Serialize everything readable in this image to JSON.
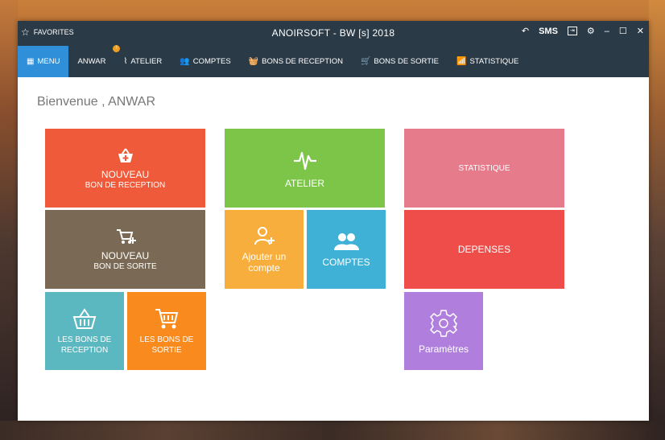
{
  "window": {
    "favorites_label": "FAVORITES",
    "title": "ANOIRSOFT - BW [s] 2018",
    "sms_label": "SMS"
  },
  "menu": {
    "items": [
      {
        "label": "MENU",
        "icon": "grid-icon"
      },
      {
        "label": "ANWAR",
        "icon": "user-icon",
        "badge": "!"
      },
      {
        "label": "ATELIER",
        "icon": "pulse-icon"
      },
      {
        "label": "COMPTES",
        "icon": "users-icon"
      },
      {
        "label": "BONS DE RECEPTION",
        "icon": "basket-icon"
      },
      {
        "label": "BONS DE SORTIE",
        "icon": "cart-icon"
      },
      {
        "label": "STATISTIQUE",
        "icon": "bar-chart-icon"
      }
    ]
  },
  "welcome": "Bienvenue , ANWAR",
  "tiles": {
    "nouveau_reception": {
      "line1": "NOUVEAU",
      "line2": "BON DE RECEPTION",
      "color": "#ef5a3a"
    },
    "nouveau_sortie": {
      "line1": "NOUVEAU",
      "line2": "BON DE SORITE",
      "color": "#7a6a55"
    },
    "les_bons_reception": {
      "line1": "LES BONS DE",
      "line2": "RECEPTION",
      "color": "#5bb8c0"
    },
    "les_bons_sortie": {
      "line1": "LES BONS DE",
      "line2": "SORTIE",
      "color": "#f98a1e"
    },
    "atelier": {
      "label": "ATELIER",
      "color": "#7cc549"
    },
    "ajouter_compte": {
      "line1": "Ajouter un",
      "line2": "compte",
      "color": "#f8ae3c"
    },
    "comptes": {
      "label": "COMPTES",
      "color": "#3fb0d6"
    },
    "statistique": {
      "label": "STATISTIQUE",
      "color": "#e67b8c"
    },
    "depenses": {
      "label": "DEPENSES",
      "color": "#ee4d4a"
    },
    "parametres": {
      "label": "Paramètres",
      "color": "#b07fde"
    }
  }
}
